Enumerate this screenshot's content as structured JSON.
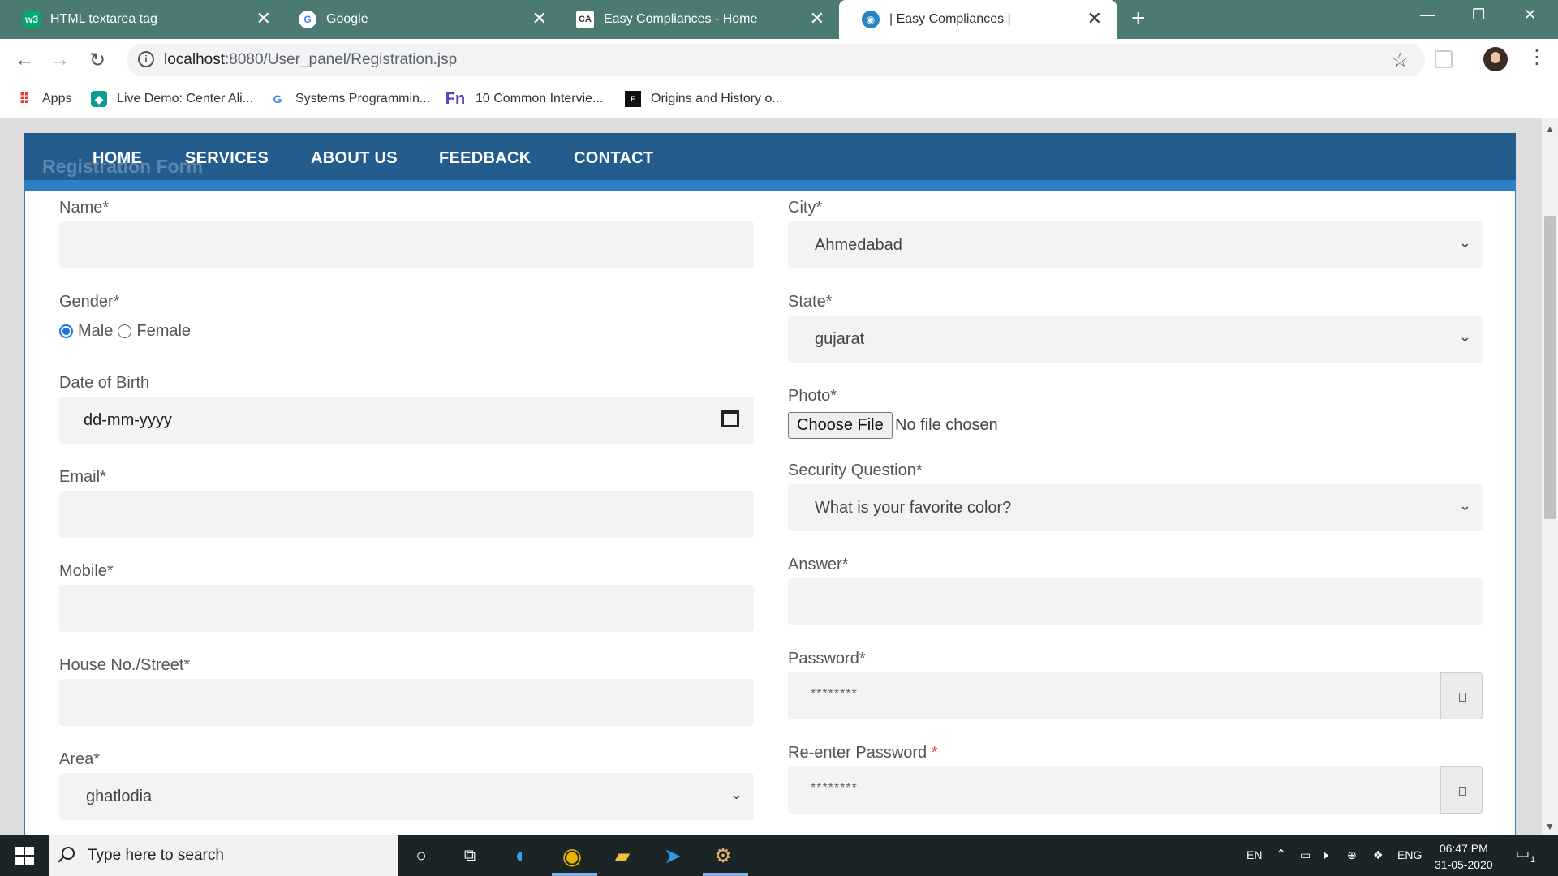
{
  "browser": {
    "tabs": [
      {
        "title": "HTML textarea tag",
        "icon": "w3-icon"
      },
      {
        "title": "Google",
        "icon": "google-icon"
      },
      {
        "title": "Easy Compliances - Home",
        "icon": "ca-icon"
      },
      {
        "title": "| Easy Compliances |",
        "icon": "globe-icon",
        "active": true
      }
    ],
    "url_host": "localhost",
    "url_path": ":8080/User_panel/Registration.jsp",
    "bookmarks": [
      {
        "label": "Apps"
      },
      {
        "label": "Live Demo: Center Ali..."
      },
      {
        "label": "Systems Programmin..."
      },
      {
        "label": "10 Common Intervie..."
      },
      {
        "label": "Origins and History o..."
      }
    ]
  },
  "page": {
    "form_title": "Registration Form",
    "nav": [
      "HOME",
      "SERVICES",
      "ABOUT US",
      "FEEDBACK",
      "CONTACT"
    ],
    "left": {
      "name_label": "Name*",
      "gender_label": "Gender*",
      "gender_male": "Male",
      "gender_female": "Female",
      "gender_selected": "Male",
      "dob_label": "Date of Birth",
      "dob_placeholder": "dd-mm-yyyy",
      "email_label": "Email*",
      "mobile_label": "Mobile*",
      "house_label": "House No./Street*",
      "area_label": "Area*",
      "area_value": "ghatlodia"
    },
    "right": {
      "city_label": "City*",
      "city_value": "Ahmedabad",
      "state_label": "State*",
      "state_value": "gujarat",
      "photo_label": "Photo*",
      "photo_button": "Choose File",
      "photo_status": "No file chosen",
      "security_label": "Security Question*",
      "security_value": "What is your favorite color?",
      "answer_label": "Answer*",
      "password_label": "Password*",
      "password_mask": "********",
      "reenter_label": "Re-enter Password ",
      "reenter_req": "*",
      "reenter_mask": "********"
    }
  },
  "taskbar": {
    "search_placeholder": "Type here to search",
    "lang_short": "EN",
    "lang": "ENG",
    "time": "06:47 PM",
    "date": "31-05-2020",
    "notifications": "1"
  }
}
